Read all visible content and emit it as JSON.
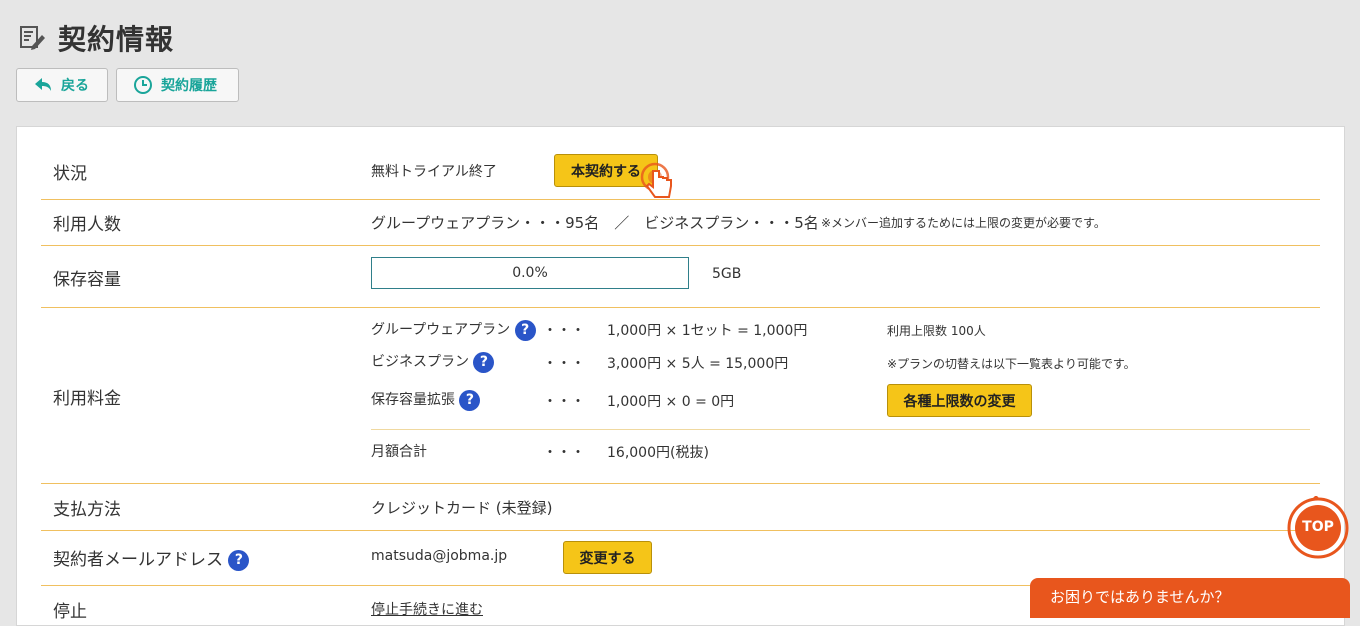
{
  "header": {
    "title": "契約情報",
    "icon": "edit-document-icon"
  },
  "nav": {
    "back_label": "戻る",
    "history_label": "契約履歴"
  },
  "rows": {
    "status": {
      "label": "状況",
      "value": "無料トライアル終了",
      "action_label": "本契約する"
    },
    "users": {
      "label": "利用人数",
      "value": "グループウェアプラン・・・95名　／　ビジネスプラン・・・5名",
      "note": "※メンバー追加するためには上限の変更が必要です。"
    },
    "storage": {
      "label": "保存容量",
      "progress_text": "0.0%",
      "progress_fraction": 0.0,
      "capacity": "5GB"
    },
    "fees": {
      "label": "利用料金",
      "items": [
        {
          "name": "グループウェアプラン",
          "dots": "・・・",
          "calc": "1,000円 × 1セット = 1,000円",
          "note": "利用上限数 100人"
        },
        {
          "name": "ビジネスプラン",
          "dots": "・・・",
          "calc": "3,000円 × 5人 = 15,000円",
          "note": "※プランの切替えは以下一覧表より可能です。"
        },
        {
          "name": "保存容量拡張",
          "dots": "・・・",
          "calc": "1,000円 × 0 = 0円"
        }
      ],
      "change_limits_label": "各種上限数の変更",
      "total_label": "月額合計",
      "total_dots": "・・・",
      "total_value": "16,000円(税抜)"
    },
    "payment": {
      "label": "支払方法",
      "value": "クレジットカード (未登録)"
    },
    "email": {
      "label": "契約者メールアドレス",
      "value": "matsuda@jobma.jp",
      "change_label": "変更する"
    },
    "stop": {
      "label": "停止",
      "link": "停止手続きに進む"
    }
  },
  "floating": {
    "top_label": "TOP",
    "help_label": "お困りではありませんか？"
  },
  "colors": {
    "accent": "#1aa59a",
    "yellow": "#f5c518",
    "orange": "#e8561d",
    "help_blue": "#2a55c8",
    "divider": "#f0c060"
  }
}
